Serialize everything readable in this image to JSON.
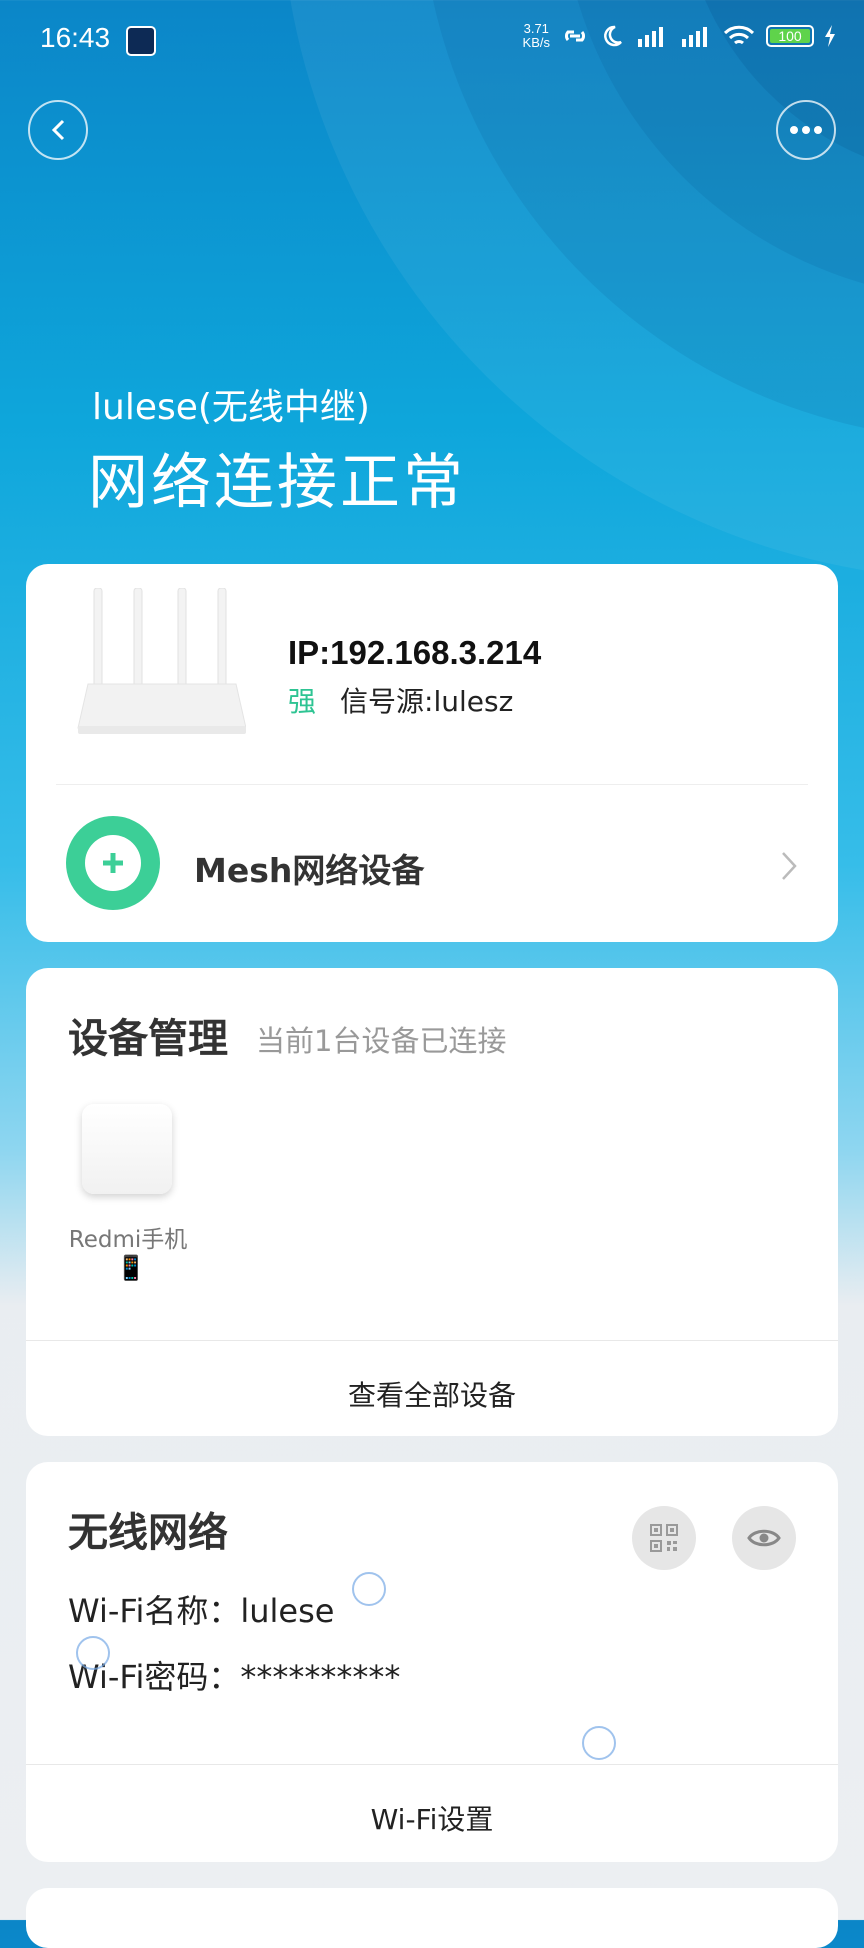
{
  "status_bar": {
    "time": "16:43",
    "net_speed_value": "3.71",
    "net_speed_unit": "KB/s",
    "battery": "100"
  },
  "header": {
    "subtitle": "lulese(无线中继)",
    "title": "网络连接正常"
  },
  "router_card": {
    "ip": "IP:192.168.3.214",
    "signal_strength": "强",
    "signal_source": "信号源:lulesz",
    "mesh_label": "Mesh网络设备"
  },
  "device_card": {
    "title": "设备管理",
    "subtitle": "当前1台设备已连接",
    "devices": [
      {
        "name": "Redmi手机",
        "type_icon": "📱"
      }
    ],
    "view_all": "查看全部设备"
  },
  "wifi_card": {
    "title": "无线网络",
    "name_line": "Wi-Fi名称：lulese",
    "password_line": "Wi-Fi密码：**********",
    "settings": "Wi-Fi设置"
  },
  "colors": {
    "accent_green": "#3ccf97",
    "hero_blue": "#0b86c8"
  }
}
